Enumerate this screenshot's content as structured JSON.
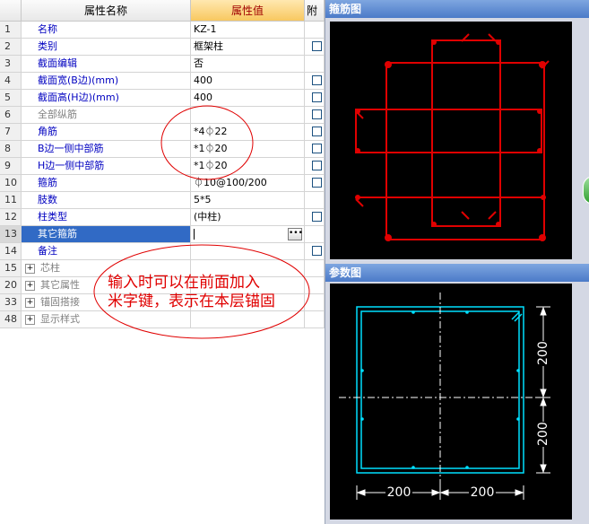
{
  "grid": {
    "headers": {
      "num": "",
      "name": "属性名称",
      "value": "属性值",
      "extra": "附加"
    },
    "rows": [
      {
        "num": "1",
        "name": "名称",
        "value": "KZ-1",
        "check": false,
        "style": ""
      },
      {
        "num": "2",
        "name": "类别",
        "value": "框架柱",
        "check": true,
        "style": ""
      },
      {
        "num": "3",
        "name": "截面编辑",
        "value": "否",
        "check": false,
        "style": ""
      },
      {
        "num": "4",
        "name": "截面宽(B边)(mm)",
        "value": "400",
        "check": true,
        "style": ""
      },
      {
        "num": "5",
        "name": "截面高(H边)(mm)",
        "value": "400",
        "check": true,
        "style": ""
      },
      {
        "num": "6",
        "name": "全部纵筋",
        "value": "",
        "check": true,
        "style": "gray"
      },
      {
        "num": "7",
        "name": "角筋",
        "value": "*4⏀22",
        "check": true,
        "style": ""
      },
      {
        "num": "8",
        "name": "B边一侧中部筋",
        "value": "*1⏀20",
        "check": true,
        "style": ""
      },
      {
        "num": "9",
        "name": "H边一侧中部筋",
        "value": "*1⏀20",
        "check": true,
        "style": ""
      },
      {
        "num": "10",
        "name": "箍筋",
        "value": "⏀10@100/200",
        "check": true,
        "style": ""
      },
      {
        "num": "11",
        "name": "肢数",
        "value": "5*5",
        "check": false,
        "style": ""
      },
      {
        "num": "12",
        "name": "柱类型",
        "value": "(中柱)",
        "check": true,
        "style": ""
      },
      {
        "num": "13",
        "name": "其它箍筋",
        "value": "",
        "check": false,
        "style": "sel"
      },
      {
        "num": "14",
        "name": "备注",
        "value": "",
        "check": true,
        "style": ""
      },
      {
        "num": "15",
        "name": "芯柱",
        "value": "",
        "check": false,
        "style": "grp"
      },
      {
        "num": "20",
        "name": "其它属性",
        "value": "",
        "check": false,
        "style": "grp"
      },
      {
        "num": "33",
        "name": "锚固搭接",
        "value": "",
        "check": false,
        "style": "grp"
      },
      {
        "num": "48",
        "name": "显示样式",
        "value": "",
        "check": false,
        "style": "grp"
      }
    ]
  },
  "annotation": {
    "line1": "输入时可以在前面加入",
    "line2": "米字键，表示在本层锚固"
  },
  "stirrup_panel": {
    "title": "箍筋图"
  },
  "param_panel": {
    "title": "参数图",
    "dim_right_top": "200",
    "dim_right_bottom": "200",
    "dim_bottom_left": "200",
    "dim_bottom_right": "200"
  },
  "colors": {
    "rebar": "#e00000",
    "param_line": "#00e0ff",
    "dim": "#ffffff",
    "annotation": "#e00000"
  },
  "icons": {
    "ellipsis": "ellipsis-icon",
    "expand": "plus-icon"
  }
}
